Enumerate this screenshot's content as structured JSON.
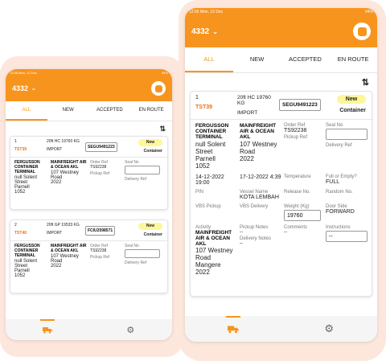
{
  "status_time": "12:56  Mon, 12 Dec",
  "status_battery": "94%",
  "depot": "4332",
  "tabs": [
    "ALL",
    "NEW",
    "ACCEPTED",
    "EN ROUTE"
  ],
  "card1": {
    "num": "1",
    "id": "TST39",
    "type": "20ft HC 19760 KG",
    "move": "IMPORT",
    "container_no": "SEGU9491223",
    "status": "New",
    "category": "Container",
    "from": "FERGUSSON CONTAINER TERMINAL",
    "from_addr": [
      "null Solent",
      "Street",
      "Parnell",
      "1052"
    ],
    "to": "MAINFREIGHT AIR & OCEAN AKL",
    "to_addr": [
      "107 Westney",
      "Road",
      "2022"
    ],
    "order_ref_label": "Order Ref",
    "order_ref": "TS92238",
    "pickup_ref_label": "Pickup Ref",
    "seal_label": "Seal No",
    "delivery_ref_label": "Delivery Ref"
  },
  "card2": {
    "num": "2",
    "id": "TST40",
    "type": "20ft GP 19533 KG",
    "move": "IMPORT",
    "container_no": "FCIU2598571",
    "status": "New",
    "category": "Container",
    "from": "FERGUSSON CONTAINER TERMINAL",
    "from_addr": [
      "null Solent",
      "Street",
      "Parnell",
      "1052"
    ],
    "to": "MAINFREIGHT AIR & OCEAN AKL",
    "to_addr": [
      "107 Westney",
      "Road",
      "2022"
    ],
    "order_ref_label": "Order Ref",
    "order_ref": "TS92238",
    "pickup_ref_label": "Pickup Ref",
    "seal_label": "Seal No",
    "delivery_ref_label": "Delivery Ref"
  },
  "detail": {
    "date1": "14-12-2022 19:00",
    "date2": "17-12-2022 4:39",
    "temperature_label": "Temperature",
    "full_label": "Full or Empty?",
    "full_value": "FULL",
    "pin_label": "PIN",
    "vessel_label": "Vessel Name",
    "vessel_value": "KOTA LEMBAH",
    "release_label": "Release No.",
    "random_label": "Random No.",
    "vbs_pickup_label": "VBS Pickup",
    "vbs_delivery_label": "VBS Delivery",
    "weight_label": "Weight (Kg)",
    "weight_value": "19760",
    "door_label": "Door Side",
    "door_value": "FORWARD",
    "activity_label": "Activity",
    "activity_name": "MAINFREIGHT AIR & OCEAN AKL",
    "activity_addr": [
      "107 Westney",
      "Road",
      "Mangere",
      "2022"
    ],
    "pickup_notes_label": "Pickup Notes",
    "pickup_notes_value": "--",
    "delivery_notes_label": "Delivery Notes",
    "delivery_notes_value": "--",
    "comments_label": "Comments",
    "comments_value": "--",
    "instructions_label": "Instructions",
    "instructions_value": "--"
  },
  "colors": {
    "accent": "#f7941d",
    "pill": "#fdf79a",
    "id_text": "#e8701a",
    "blob": "#fde7dc"
  }
}
